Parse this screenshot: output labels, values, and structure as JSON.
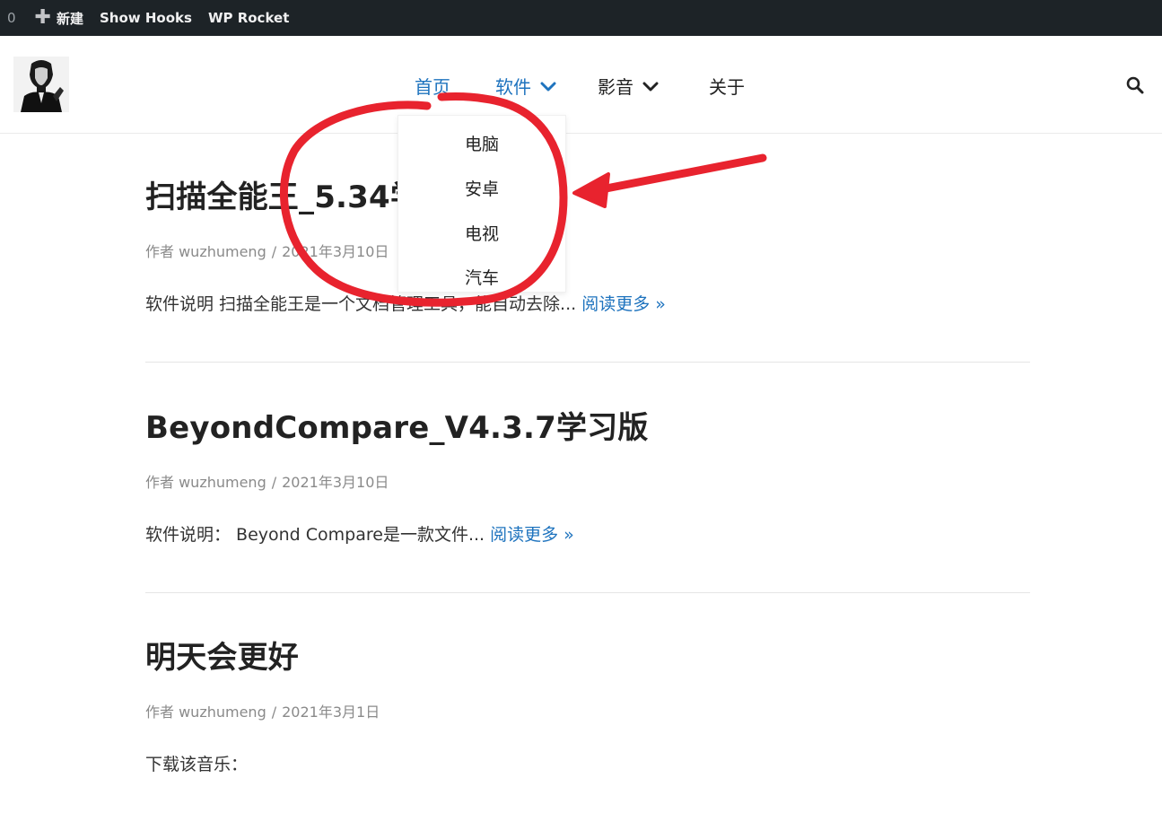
{
  "admin_bar": {
    "count": "0",
    "new_label": "新建",
    "show_hooks_label": "Show Hooks",
    "wp_rocket_label": "WP Rocket"
  },
  "nav": {
    "home": "首页",
    "software": "软件",
    "media": "影音",
    "about": "关于"
  },
  "submenu": {
    "items": [
      "电脑",
      "安卓",
      "电视",
      "汽车"
    ]
  },
  "posts": [
    {
      "title": "扫描全能王_5.34学习版",
      "author": "作者 wuzhumeng",
      "separator": "/",
      "date": "2021年3月10日",
      "excerpt": "软件说明 扫描全能王是一个文档管理工具，能自动去除...",
      "read_more": "阅读更多 »"
    },
    {
      "title": "BeyondCompare_V4.3.7学习版",
      "author": "作者 wuzhumeng",
      "separator": "/",
      "date": "2021年3月10日",
      "excerpt": "软件说明：  Beyond Compare是一款文件...",
      "read_more": "阅读更多 »"
    },
    {
      "title": "明天会更好",
      "author": "作者 wuzhumeng",
      "separator": "/",
      "date": "2021年3月1日",
      "excerpt": "下载该音乐：",
      "read_more": ""
    }
  ],
  "colors": {
    "accent": "#1e73be",
    "admin_bar": "#1d2327",
    "annotation": "#e8232e"
  },
  "icons": {
    "search": "search-icon",
    "chevron": "chevron-down-icon",
    "plus": "plus-icon"
  }
}
